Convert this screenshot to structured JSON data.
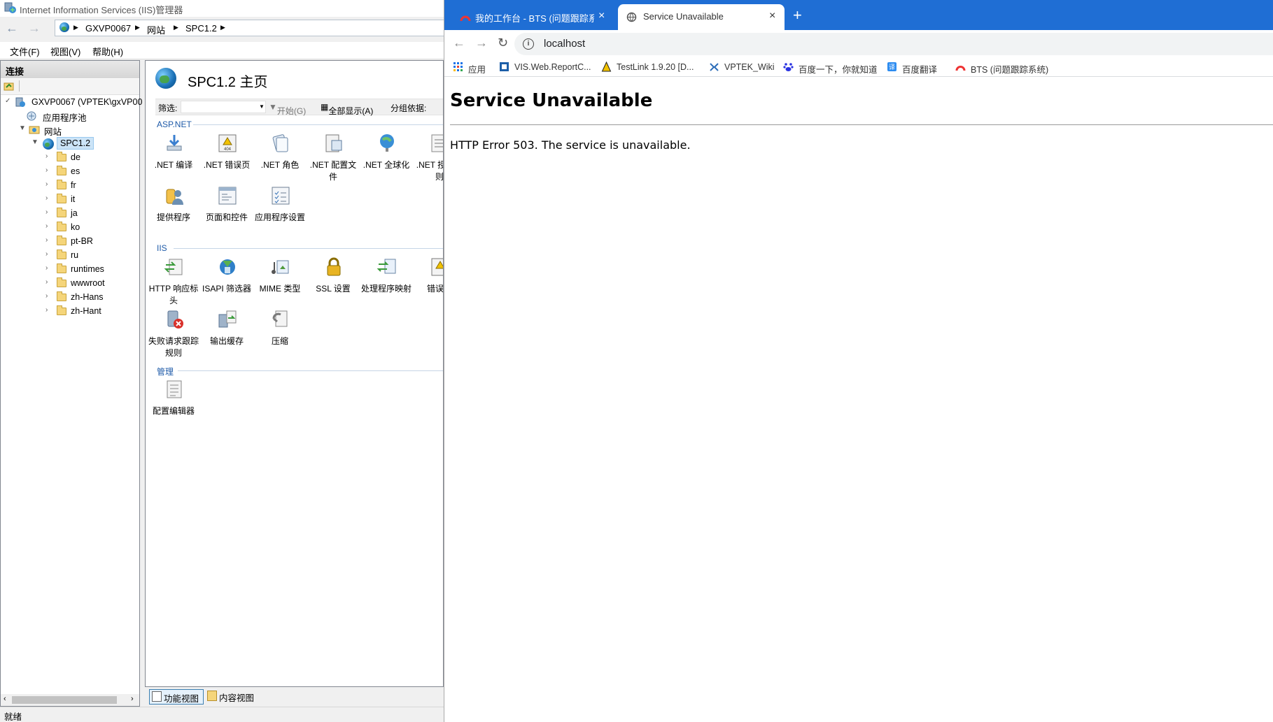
{
  "iis": {
    "window_title": "Internet Information Services (IIS)管理器",
    "address_segments": [
      "GXVP0067",
      "网站",
      "SPC1.2"
    ],
    "menu": [
      "文件(F)",
      "视图(V)",
      "帮助(H)"
    ],
    "connections": {
      "title": "连接",
      "tree": [
        {
          "label": "GXVP0067 (VPTEK\\gxVP00",
          "level": 0,
          "expanded": true,
          "icon": "server-icon"
        },
        {
          "label": "应用程序池",
          "level": 1,
          "icon": "app-pool-icon"
        },
        {
          "label": "网站",
          "level": 1,
          "expanded": true,
          "icon": "sites-icon"
        },
        {
          "label": "SPC1.2",
          "level": 2,
          "expanded": true,
          "selected": true,
          "icon": "site-globe-icon"
        },
        {
          "label": "de",
          "level": 3,
          "icon": "folder-icon"
        },
        {
          "label": "es",
          "level": 3,
          "icon": "folder-icon"
        },
        {
          "label": "fr",
          "level": 3,
          "icon": "folder-icon"
        },
        {
          "label": "it",
          "level": 3,
          "icon": "folder-icon"
        },
        {
          "label": "ja",
          "level": 3,
          "icon": "folder-icon"
        },
        {
          "label": "ko",
          "level": 3,
          "icon": "folder-icon"
        },
        {
          "label": "pt-BR",
          "level": 3,
          "icon": "folder-icon"
        },
        {
          "label": "ru",
          "level": 3,
          "icon": "folder-icon"
        },
        {
          "label": "runtimes",
          "level": 3,
          "icon": "folder-icon"
        },
        {
          "label": "wwwroot",
          "level": 3,
          "icon": "folder-icon"
        },
        {
          "label": "zh-Hans",
          "level": 3,
          "icon": "folder-icon"
        },
        {
          "label": "zh-Hant",
          "level": 3,
          "icon": "folder-icon"
        }
      ]
    },
    "home": {
      "title": "SPC1.2 主页",
      "filter_label": "筛选:",
      "start_label": "开始(G)",
      "show_all_label": "全部显示(A)",
      "group_by_label": "分组依据:",
      "groups": [
        {
          "name": "ASP.NET",
          "items": [
            ".NET 编译",
            ".NET 错误页",
            ".NET 角色",
            ".NET 配置文件",
            ".NET 全球化",
            ".NET 授权规则",
            "提供程序",
            "页面和控件",
            "应用程序设置"
          ]
        },
        {
          "name": "IIS",
          "items": [
            "HTTP 响应标头",
            "ISAPI 筛选器",
            "MIME 类型",
            "SSL 设置",
            "处理程序映射",
            "错误页",
            "失败请求跟踪规则",
            "输出缓存",
            "压缩"
          ]
        },
        {
          "name": "管理",
          "items": [
            "配置编辑器"
          ]
        }
      ]
    },
    "view_tabs": [
      "功能视图",
      "内容视图"
    ],
    "status": "就绪"
  },
  "chrome": {
    "tabs": [
      {
        "title": "我的工作台 - BTS (问题跟踪系统",
        "active": false
      },
      {
        "title": "Service Unavailable",
        "active": true
      }
    ],
    "url": "localhost",
    "bookmarks": [
      "应用",
      "VIS.Web.ReportC...",
      "TestLink 1.9.20 [D...",
      "VPTEK_Wiki",
      "百度一下，你就知道",
      "百度翻译",
      "BTS (问题跟踪系统)"
    ],
    "page": {
      "heading": "Service Unavailable",
      "message": "HTTP Error 503. The service is unavailable."
    },
    "colors": {
      "tabstrip": "#1f6ed4"
    }
  }
}
